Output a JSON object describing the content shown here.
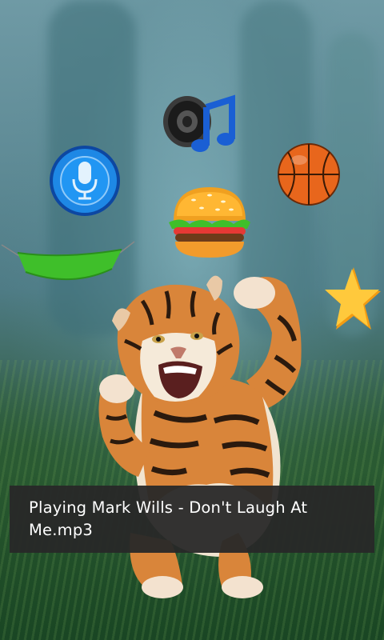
{
  "toast": {
    "message": "Playing Mark Wills - Don't Laugh At Me.mp3"
  },
  "icons": [
    {
      "name": "music-icon",
      "depicts": "speaker with music note"
    },
    {
      "name": "microphone-icon",
      "depicts": "blue circular microphone button"
    },
    {
      "name": "basketball-icon",
      "depicts": "orange basketball"
    },
    {
      "name": "burger-icon",
      "depicts": "hamburger"
    },
    {
      "name": "hammock-icon",
      "depicts": "green hammock"
    },
    {
      "name": "star-icon",
      "depicts": "gold star"
    }
  ],
  "colors": {
    "toast_bg": "#2b2b2b",
    "mic_blue": "#1e88e5",
    "hammock_green": "#3fbf2a",
    "star_gold": "#ffc107",
    "ball_orange": "#e8661c"
  }
}
